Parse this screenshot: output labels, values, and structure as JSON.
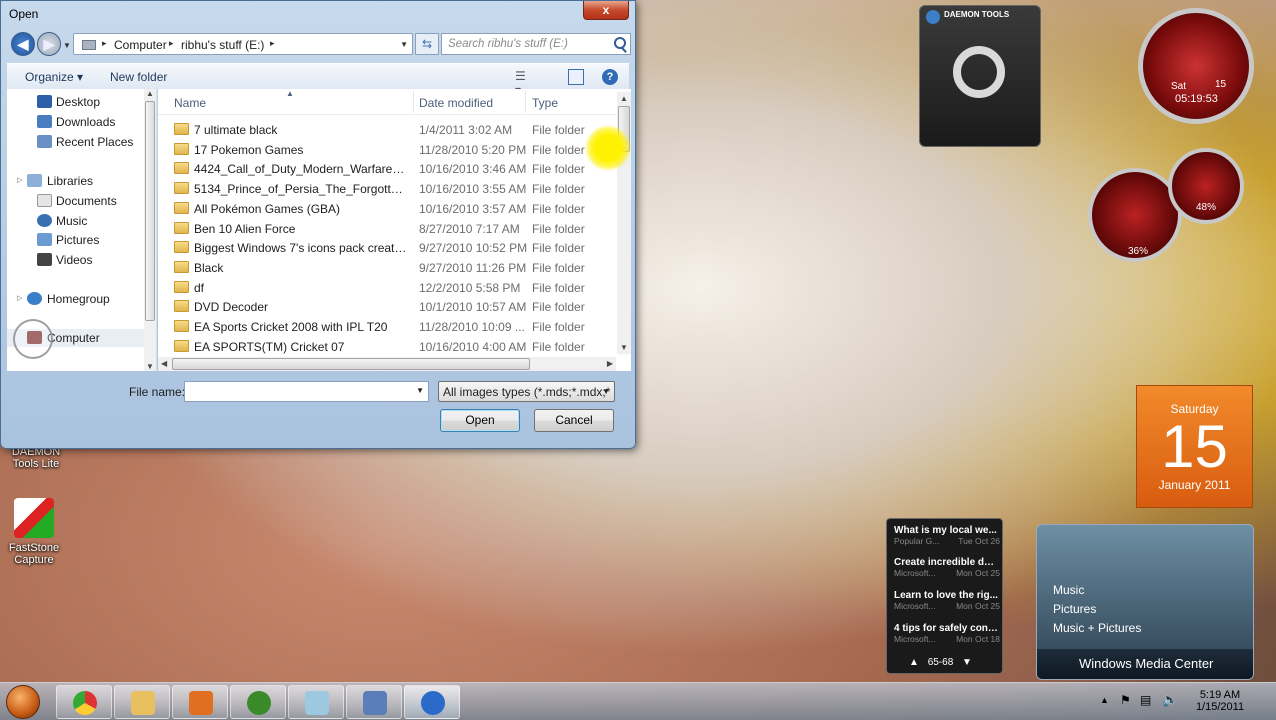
{
  "dialog": {
    "title": "Open",
    "close_label": "x",
    "address": [
      "Computer",
      "ribhu's stuff (E:)"
    ],
    "search_placeholder": "Search ribhu's stuff (E:)",
    "toolbar": {
      "organize": "Organize ▾",
      "new_folder": "New folder",
      "help": "?"
    },
    "nav_pane": {
      "favorites": [
        "Desktop",
        "Downloads",
        "Recent Places"
      ],
      "libraries_label": "Libraries",
      "libraries": [
        "Documents",
        "Music",
        "Pictures",
        "Videos"
      ],
      "homegroup": "Homegroup",
      "computer": "Computer"
    },
    "columns": {
      "name": "Name",
      "date": "Date modified",
      "type": "Type"
    },
    "files": [
      {
        "name": "7 ultimate black",
        "date": "1/4/2011 3:02 AM",
        "type": "File folder"
      },
      {
        "name": "17 Pokemon Games",
        "date": "11/28/2010 5:20 PM",
        "type": "File folder"
      },
      {
        "name": "4424_Call_of_Duty_Modern_Warfare_Mo...",
        "date": "10/16/2010 3:46 AM",
        "type": "File folder"
      },
      {
        "name": "5134_Prince_of_Persia_The_Forgotten_Sa...",
        "date": "10/16/2010 3:55 AM",
        "type": "File folder"
      },
      {
        "name": "All Pokémon Games (GBA)",
        "date": "10/16/2010 3:57 AM",
        "type": "File folder"
      },
      {
        "name": "Ben 10 Alien Force",
        "date": "8/27/2010 7:17 AM",
        "type": "File folder"
      },
      {
        "name": "Biggest Windows 7's icons pack created ...",
        "date": "9/27/2010 10:52 PM",
        "type": "File folder"
      },
      {
        "name": "Black",
        "date": "9/27/2010 11:26 PM",
        "type": "File folder"
      },
      {
        "name": "df",
        "date": "12/2/2010 5:58 PM",
        "type": "File folder"
      },
      {
        "name": "DVD Decoder",
        "date": "10/1/2010 10:57 AM",
        "type": "File folder"
      },
      {
        "name": "EA Sports Cricket 2008 with IPL T20",
        "date": "11/28/2010 10:09 ...",
        "type": "File folder"
      },
      {
        "name": "EA SPORTS(TM) Cricket 07",
        "date": "10/16/2010 4:00 AM",
        "type": "File folder"
      }
    ],
    "file_name_label": "File name:",
    "file_name_value": "",
    "filter": "All images types (*.mds;*.mdx;*",
    "open_label": "Open",
    "cancel_label": "Cancel"
  },
  "desktop_icons": [
    {
      "label": "DAEMON Tools Lite"
    },
    {
      "label": "FastStone Capture"
    }
  ],
  "gadgets": {
    "daemon_header": "DAEMON TOOLS",
    "clock": {
      "day": "Sat",
      "num": "15",
      "time": "05:19:53"
    },
    "cpu_percent": "36%",
    "mem_percent": "48%",
    "calendar": {
      "weekday": "Saturday",
      "day": "15",
      "month_year": "January 2011"
    },
    "news": [
      {
        "headline": "What is my local we...",
        "source": "Popular G...",
        "date": "Tue Oct 26"
      },
      {
        "headline": "Create incredible doc...",
        "source": "Microsoft...",
        "date": "Mon Oct 25"
      },
      {
        "headline": "Learn to love the rig...",
        "source": "Microsoft...",
        "date": "Mon Oct 25"
      },
      {
        "headline": "4 tips for safely cond...",
        "source": "Microsoft...",
        "date": "Mon Oct 18"
      }
    ],
    "news_pager": "65-68",
    "media_links": [
      "Music",
      "Pictures",
      "Music + Pictures"
    ],
    "media_center": "Windows Media Center"
  },
  "taskbar": {
    "time": "5:19 AM",
    "date": "1/15/2011",
    "apps": [
      "chrome-icon",
      "explorer-icon",
      "media-player-icon",
      "utorrent-icon",
      "notepad-icon",
      "network-app-icon",
      "daemon-tools-icon"
    ]
  },
  "colors": {
    "dialog_frame": "#b4cbe3",
    "calendar": "#e06a18",
    "selection": "#3c7fb1"
  }
}
